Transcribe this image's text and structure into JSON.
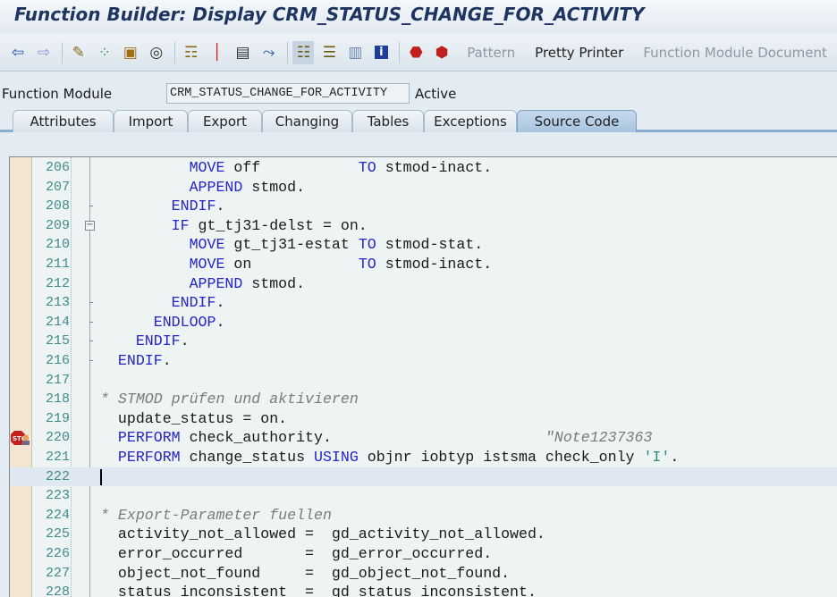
{
  "window": {
    "title": "Function Builder: Display CRM_STATUS_CHANGE_FOR_ACTIVITY"
  },
  "toolbar": {
    "icons": [
      "back-arrow-icon",
      "forward-arrow-icon",
      "edit-pencil-icon",
      "check-icon",
      "activate-icon",
      "where-used-icon",
      "object-list-icon",
      "breakpoint-icon",
      "display-object-icon",
      "navigate-icon",
      "hierarchy-icon",
      "stack-icon",
      "window-icon",
      "info-icon",
      "stop-session-icon",
      "stop-user-icon"
    ],
    "pattern_label": "Pattern",
    "pretty_printer_label": "Pretty Printer",
    "fm_doc_label": "Function Module Document"
  },
  "function_module": {
    "label": "Function Module",
    "value": "CRM_STATUS_CHANGE_FOR_ACTIVITY",
    "status": "Active"
  },
  "tabs": [
    {
      "label": "Attributes"
    },
    {
      "label": "Import"
    },
    {
      "label": "Export"
    },
    {
      "label": "Changing"
    },
    {
      "label": "Tables"
    },
    {
      "label": "Exceptions"
    },
    {
      "label": "Source Code",
      "active": true
    }
  ],
  "editor": {
    "cursor_line": 222,
    "breakpoint_line": 220,
    "lines": [
      {
        "n": "206",
        "tick": false,
        "seg": [
          [
            "txt",
            "          "
          ],
          [
            "kw",
            "MOVE"
          ],
          [
            "txt",
            " off           "
          ],
          [
            "kw",
            "TO"
          ],
          [
            "txt",
            " stmod-inact."
          ]
        ]
      },
      {
        "n": "207",
        "seg": [
          [
            "txt",
            "          "
          ],
          [
            "kw",
            "APPEND"
          ],
          [
            "txt",
            " stmod."
          ]
        ]
      },
      {
        "n": "208",
        "tick": true,
        "seg": [
          [
            "txt",
            "        "
          ],
          [
            "kw",
            "ENDIF"
          ],
          [
            "txt",
            "."
          ]
        ]
      },
      {
        "n": "209",
        "fold": true,
        "seg": [
          [
            "txt",
            "        "
          ],
          [
            "kw",
            "IF"
          ],
          [
            "txt",
            " gt_tj31-delst = on."
          ]
        ]
      },
      {
        "n": "210",
        "seg": [
          [
            "txt",
            "          "
          ],
          [
            "kw",
            "MOVE"
          ],
          [
            "txt",
            " gt_tj31-estat "
          ],
          [
            "kw",
            "TO"
          ],
          [
            "txt",
            " stmod-stat."
          ]
        ]
      },
      {
        "n": "211",
        "seg": [
          [
            "txt",
            "          "
          ],
          [
            "kw",
            "MOVE"
          ],
          [
            "txt",
            " on            "
          ],
          [
            "kw",
            "TO"
          ],
          [
            "txt",
            " stmod-inact."
          ]
        ]
      },
      {
        "n": "212",
        "seg": [
          [
            "txt",
            "          "
          ],
          [
            "kw",
            "APPEND"
          ],
          [
            "txt",
            " stmod."
          ]
        ]
      },
      {
        "n": "213",
        "tick": true,
        "seg": [
          [
            "txt",
            "        "
          ],
          [
            "kw",
            "ENDIF"
          ],
          [
            "txt",
            "."
          ]
        ]
      },
      {
        "n": "214",
        "tick": true,
        "seg": [
          [
            "txt",
            "      "
          ],
          [
            "kw",
            "ENDLOOP"
          ],
          [
            "txt",
            "."
          ]
        ]
      },
      {
        "n": "215",
        "tick": true,
        "seg": [
          [
            "txt",
            "    "
          ],
          [
            "kw",
            "ENDIF"
          ],
          [
            "txt",
            "."
          ]
        ]
      },
      {
        "n": "216",
        "tick": true,
        "seg": [
          [
            "txt",
            "  "
          ],
          [
            "kw",
            "ENDIF"
          ],
          [
            "txt",
            "."
          ]
        ]
      },
      {
        "n": "217",
        "seg": []
      },
      {
        "n": "218",
        "seg": [
          [
            "cmt",
            "* STMOD prüfen und aktivieren"
          ]
        ]
      },
      {
        "n": "219",
        "seg": [
          [
            "txt",
            "  update_status = on."
          ]
        ]
      },
      {
        "n": "220",
        "seg": [
          [
            "txt",
            "  "
          ],
          [
            "kw",
            "PERFORM"
          ],
          [
            "txt",
            " check_authority.                        "
          ],
          [
            "cmt",
            "\"Note1237363"
          ]
        ]
      },
      {
        "n": "221",
        "seg": [
          [
            "txt",
            "  "
          ],
          [
            "kw",
            "PERFORM"
          ],
          [
            "txt",
            " change_status "
          ],
          [
            "kw",
            "USING"
          ],
          [
            "txt",
            " objnr iobtyp istsma check_only "
          ],
          [
            "str",
            "'I'"
          ],
          [
            "txt",
            "."
          ]
        ]
      },
      {
        "n": "222",
        "seg": []
      },
      {
        "n": "223",
        "seg": []
      },
      {
        "n": "224",
        "seg": [
          [
            "cmt",
            "* Export-Parameter fuellen"
          ]
        ]
      },
      {
        "n": "225",
        "seg": [
          [
            "txt",
            "  activity_not_allowed =  gd_activity_not_allowed."
          ]
        ]
      },
      {
        "n": "226",
        "seg": [
          [
            "txt",
            "  error_occurred       =  gd_error_occurred."
          ]
        ]
      },
      {
        "n": "227",
        "seg": [
          [
            "txt",
            "  object_not_found     =  gd_object_not_found."
          ]
        ]
      },
      {
        "n": "228",
        "seg": [
          [
            "txt",
            "  status_inconsistent  =  gd_status_inconsistent."
          ]
        ]
      }
    ]
  }
}
